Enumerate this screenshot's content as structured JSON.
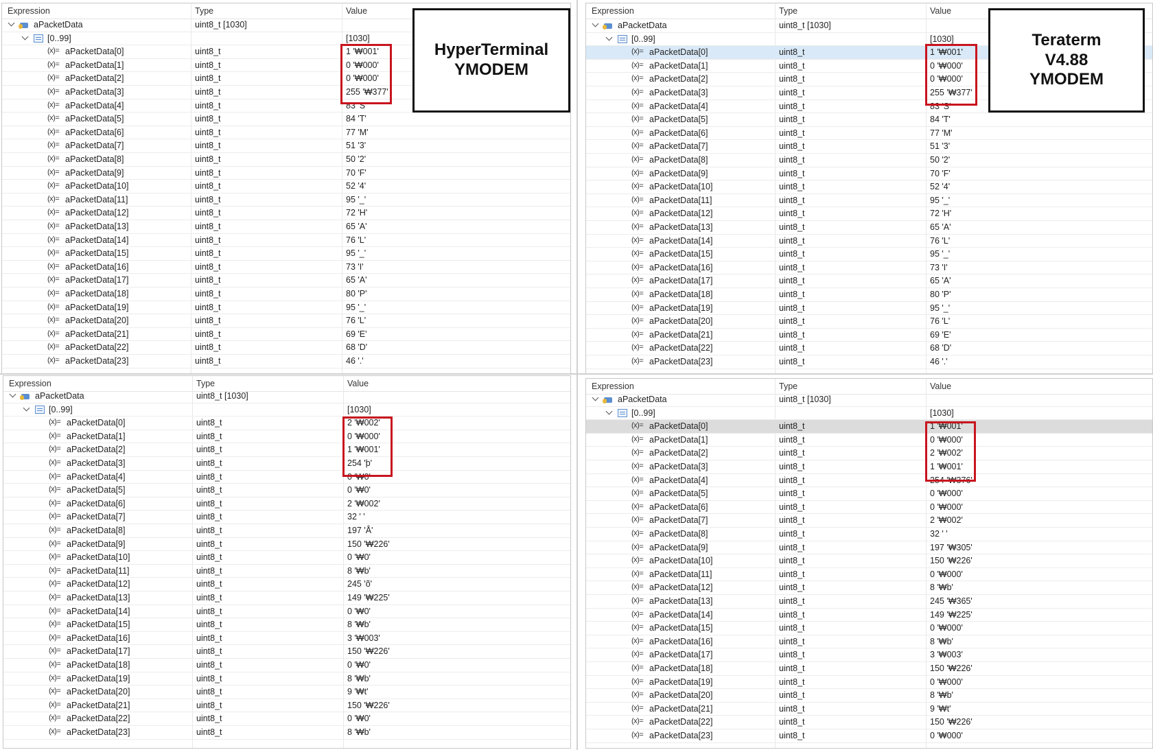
{
  "headers": {
    "expression": "Expression",
    "type": "Type",
    "value": "Value"
  },
  "labels": {
    "hyperterminal": "HyperTerminal\nYMODEM",
    "teraterm": "Teraterm\nV4.88\nYMODEM"
  },
  "panels": [
    {
      "id": "tl",
      "root": {
        "name": "aPacketData",
        "type": "uint8_t [1030]",
        "value": ""
      },
      "range": {
        "name": "[0..99]",
        "value": "[1030]"
      },
      "selected": -1,
      "selected_style": "",
      "items": [
        {
          "name": "aPacketData[0]",
          "type": "uint8_t",
          "value": "1 '₩001'"
        },
        {
          "name": "aPacketData[1]",
          "type": "uint8_t",
          "value": "0 '₩000'"
        },
        {
          "name": "aPacketData[2]",
          "type": "uint8_t",
          "value": "0 '₩000'"
        },
        {
          "name": "aPacketData[3]",
          "type": "uint8_t",
          "value": "255 '₩377'"
        },
        {
          "name": "aPacketData[4]",
          "type": "uint8_t",
          "value": "83 'S'"
        },
        {
          "name": "aPacketData[5]",
          "type": "uint8_t",
          "value": "84 'T'"
        },
        {
          "name": "aPacketData[6]",
          "type": "uint8_t",
          "value": "77 'M'"
        },
        {
          "name": "aPacketData[7]",
          "type": "uint8_t",
          "value": "51 '3'"
        },
        {
          "name": "aPacketData[8]",
          "type": "uint8_t",
          "value": "50 '2'"
        },
        {
          "name": "aPacketData[9]",
          "type": "uint8_t",
          "value": "70 'F'"
        },
        {
          "name": "aPacketData[10]",
          "type": "uint8_t",
          "value": "52 '4'"
        },
        {
          "name": "aPacketData[11]",
          "type": "uint8_t",
          "value": "95 '_'"
        },
        {
          "name": "aPacketData[12]",
          "type": "uint8_t",
          "value": "72 'H'"
        },
        {
          "name": "aPacketData[13]",
          "type": "uint8_t",
          "value": "65 'A'"
        },
        {
          "name": "aPacketData[14]",
          "type": "uint8_t",
          "value": "76 'L'"
        },
        {
          "name": "aPacketData[15]",
          "type": "uint8_t",
          "value": "95 '_'"
        },
        {
          "name": "aPacketData[16]",
          "type": "uint8_t",
          "value": "73 'I'"
        },
        {
          "name": "aPacketData[17]",
          "type": "uint8_t",
          "value": "65 'A'"
        },
        {
          "name": "aPacketData[18]",
          "type": "uint8_t",
          "value": "80 'P'"
        },
        {
          "name": "aPacketData[19]",
          "type": "uint8_t",
          "value": "95 '_'"
        },
        {
          "name": "aPacketData[20]",
          "type": "uint8_t",
          "value": "76 'L'"
        },
        {
          "name": "aPacketData[21]",
          "type": "uint8_t",
          "value": "69 'E'"
        },
        {
          "name": "aPacketData[22]",
          "type": "uint8_t",
          "value": "68 'D'"
        },
        {
          "name": "aPacketData[23]",
          "type": "uint8_t",
          "value": "46 '.'"
        }
      ]
    },
    {
      "id": "tr",
      "root": {
        "name": "aPacketData",
        "type": "uint8_t [1030]",
        "value": ""
      },
      "range": {
        "name": "[0..99]",
        "value": "[1030]"
      },
      "selected": 0,
      "selected_style": "blue",
      "items": [
        {
          "name": "aPacketData[0]",
          "type": "uint8_t",
          "value": "1 '₩001'"
        },
        {
          "name": "aPacketData[1]",
          "type": "uint8_t",
          "value": "0 '₩000'"
        },
        {
          "name": "aPacketData[2]",
          "type": "uint8_t",
          "value": "0 '₩000'"
        },
        {
          "name": "aPacketData[3]",
          "type": "uint8_t",
          "value": "255 '₩377'"
        },
        {
          "name": "aPacketData[4]",
          "type": "uint8_t",
          "value": "83 'S'"
        },
        {
          "name": "aPacketData[5]",
          "type": "uint8_t",
          "value": "84 'T'"
        },
        {
          "name": "aPacketData[6]",
          "type": "uint8_t",
          "value": "77 'M'"
        },
        {
          "name": "aPacketData[7]",
          "type": "uint8_t",
          "value": "51 '3'"
        },
        {
          "name": "aPacketData[8]",
          "type": "uint8_t",
          "value": "50 '2'"
        },
        {
          "name": "aPacketData[9]",
          "type": "uint8_t",
          "value": "70 'F'"
        },
        {
          "name": "aPacketData[10]",
          "type": "uint8_t",
          "value": "52 '4'"
        },
        {
          "name": "aPacketData[11]",
          "type": "uint8_t",
          "value": "95 '_'"
        },
        {
          "name": "aPacketData[12]",
          "type": "uint8_t",
          "value": "72 'H'"
        },
        {
          "name": "aPacketData[13]",
          "type": "uint8_t",
          "value": "65 'A'"
        },
        {
          "name": "aPacketData[14]",
          "type": "uint8_t",
          "value": "76 'L'"
        },
        {
          "name": "aPacketData[15]",
          "type": "uint8_t",
          "value": "95 '_'"
        },
        {
          "name": "aPacketData[16]",
          "type": "uint8_t",
          "value": "73 'I'"
        },
        {
          "name": "aPacketData[17]",
          "type": "uint8_t",
          "value": "65 'A'"
        },
        {
          "name": "aPacketData[18]",
          "type": "uint8_t",
          "value": "80 'P'"
        },
        {
          "name": "aPacketData[19]",
          "type": "uint8_t",
          "value": "95 '_'"
        },
        {
          "name": "aPacketData[20]",
          "type": "uint8_t",
          "value": "76 'L'"
        },
        {
          "name": "aPacketData[21]",
          "type": "uint8_t",
          "value": "69 'E'"
        },
        {
          "name": "aPacketData[22]",
          "type": "uint8_t",
          "value": "68 'D'"
        },
        {
          "name": "aPacketData[23]",
          "type": "uint8_t",
          "value": "46 '.'"
        }
      ]
    },
    {
      "id": "bl",
      "root": {
        "name": "aPacketData",
        "type": "uint8_t [1030]",
        "value": ""
      },
      "range": {
        "name": "[0..99]",
        "value": "[1030]"
      },
      "selected": -2,
      "selected_style": "",
      "items": [
        {
          "name": "aPacketData[0]",
          "type": "uint8_t",
          "value": "2 '₩002'"
        },
        {
          "name": "aPacketData[1]",
          "type": "uint8_t",
          "value": "0 '₩000'"
        },
        {
          "name": "aPacketData[2]",
          "type": "uint8_t",
          "value": "1 '₩001'"
        },
        {
          "name": "aPacketData[3]",
          "type": "uint8_t",
          "value": "254 'þ'"
        },
        {
          "name": "aPacketData[4]",
          "type": "uint8_t",
          "value": "0 '₩0'"
        },
        {
          "name": "aPacketData[5]",
          "type": "uint8_t",
          "value": "0 '₩0'"
        },
        {
          "name": "aPacketData[6]",
          "type": "uint8_t",
          "value": "2 '₩002'"
        },
        {
          "name": "aPacketData[7]",
          "type": "uint8_t",
          "value": "32 ' '"
        },
        {
          "name": "aPacketData[8]",
          "type": "uint8_t",
          "value": "197 'Å'"
        },
        {
          "name": "aPacketData[9]",
          "type": "uint8_t",
          "value": "150 '₩226'"
        },
        {
          "name": "aPacketData[10]",
          "type": "uint8_t",
          "value": "0 '₩0'"
        },
        {
          "name": "aPacketData[11]",
          "type": "uint8_t",
          "value": "8 '₩b'"
        },
        {
          "name": "aPacketData[12]",
          "type": "uint8_t",
          "value": "245 'õ'"
        },
        {
          "name": "aPacketData[13]",
          "type": "uint8_t",
          "value": "149 '₩225'"
        },
        {
          "name": "aPacketData[14]",
          "type": "uint8_t",
          "value": "0 '₩0'"
        },
        {
          "name": "aPacketData[15]",
          "type": "uint8_t",
          "value": "8 '₩b'"
        },
        {
          "name": "aPacketData[16]",
          "type": "uint8_t",
          "value": "3 '₩003'"
        },
        {
          "name": "aPacketData[17]",
          "type": "uint8_t",
          "value": "150 '₩226'"
        },
        {
          "name": "aPacketData[18]",
          "type": "uint8_t",
          "value": "0 '₩0'"
        },
        {
          "name": "aPacketData[19]",
          "type": "uint8_t",
          "value": "8 '₩b'"
        },
        {
          "name": "aPacketData[20]",
          "type": "uint8_t",
          "value": "9 '₩t'"
        },
        {
          "name": "aPacketData[21]",
          "type": "uint8_t",
          "value": "150 '₩226'"
        },
        {
          "name": "aPacketData[22]",
          "type": "uint8_t",
          "value": "0 '₩0'"
        },
        {
          "name": "aPacketData[23]",
          "type": "uint8_t",
          "value": "8 '₩b'"
        }
      ]
    },
    {
      "id": "br",
      "root": {
        "name": "aPacketData",
        "type": "uint8_t [1030]",
        "value": ""
      },
      "range": {
        "name": "[0..99]",
        "value": "[1030]"
      },
      "selected": 0,
      "selected_style": "gray",
      "items": [
        {
          "name": "aPacketData[0]",
          "type": "uint8_t",
          "value": "1 '₩001'"
        },
        {
          "name": "aPacketData[1]",
          "type": "uint8_t",
          "value": "0 '₩000'"
        },
        {
          "name": "aPacketData[2]",
          "type": "uint8_t",
          "value": "2 '₩002'"
        },
        {
          "name": "aPacketData[3]",
          "type": "uint8_t",
          "value": "1 '₩001'"
        },
        {
          "name": "aPacketData[4]",
          "type": "uint8_t",
          "value": "254 '₩376'"
        },
        {
          "name": "aPacketData[5]",
          "type": "uint8_t",
          "value": "0 '₩000'"
        },
        {
          "name": "aPacketData[6]",
          "type": "uint8_t",
          "value": "0 '₩000'"
        },
        {
          "name": "aPacketData[7]",
          "type": "uint8_t",
          "value": "2 '₩002'"
        },
        {
          "name": "aPacketData[8]",
          "type": "uint8_t",
          "value": "32 ' '"
        },
        {
          "name": "aPacketData[9]",
          "type": "uint8_t",
          "value": "197 '₩305'"
        },
        {
          "name": "aPacketData[10]",
          "type": "uint8_t",
          "value": "150 '₩226'"
        },
        {
          "name": "aPacketData[11]",
          "type": "uint8_t",
          "value": "0 '₩000'"
        },
        {
          "name": "aPacketData[12]",
          "type": "uint8_t",
          "value": "8 '₩b'"
        },
        {
          "name": "aPacketData[13]",
          "type": "uint8_t",
          "value": "245 '₩365'"
        },
        {
          "name": "aPacketData[14]",
          "type": "uint8_t",
          "value": "149 '₩225'"
        },
        {
          "name": "aPacketData[15]",
          "type": "uint8_t",
          "value": "0 '₩000'"
        },
        {
          "name": "aPacketData[16]",
          "type": "uint8_t",
          "value": "8 '₩b'"
        },
        {
          "name": "aPacketData[17]",
          "type": "uint8_t",
          "value": "3 '₩003'"
        },
        {
          "name": "aPacketData[18]",
          "type": "uint8_t",
          "value": "150 '₩226'"
        },
        {
          "name": "aPacketData[19]",
          "type": "uint8_t",
          "value": "0 '₩000'"
        },
        {
          "name": "aPacketData[20]",
          "type": "uint8_t",
          "value": "8 '₩b'"
        },
        {
          "name": "aPacketData[21]",
          "type": "uint8_t",
          "value": "9 '₩t'"
        },
        {
          "name": "aPacketData[22]",
          "type": "uint8_t",
          "value": "150 '₩226'"
        },
        {
          "name": "aPacketData[23]",
          "type": "uint8_t",
          "value": "0 '₩000'"
        }
      ]
    }
  ],
  "colors": {
    "highlight": "#c8141e",
    "selection_blue": "#d9e9f7",
    "selection_gray": "#dcdcdc"
  }
}
